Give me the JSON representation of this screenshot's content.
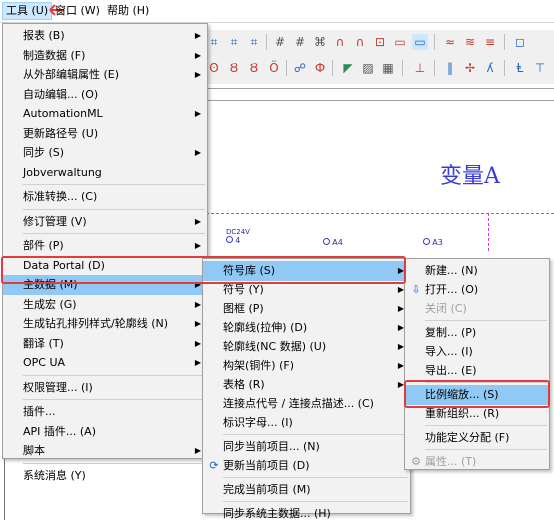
{
  "menubar": {
    "tools": "工具 (U)",
    "window": "窗口 (W)",
    "help": "帮助 (H)"
  },
  "canvas": {
    "title": "变量A",
    "connectors": [
      {
        "code": "DC24V",
        "num": "4"
      },
      {
        "code": "",
        "num": "A4"
      },
      {
        "code": "",
        "num": "A3"
      }
    ]
  },
  "tools_menu": {
    "items": [
      {
        "label": "报表 (B)",
        "sub": true
      },
      {
        "label": "制造数据 (F)",
        "sub": true
      },
      {
        "label": "从外部编辑属性 (E)",
        "sub": true
      },
      {
        "label": "自动编辑... (O)",
        "sub": false
      },
      {
        "label": "AutomationML",
        "sub": true
      },
      {
        "label": "更新路径号 (U)",
        "sub": false
      },
      {
        "label": "同步 (S)",
        "sub": true
      },
      {
        "label": "Jobverwaltung",
        "sub": false
      },
      {
        "label": "标准转换... (C)",
        "sub": false
      },
      {
        "label": "修订管理 (V)",
        "sub": true
      },
      {
        "label": "部件 (P)",
        "sub": true
      },
      {
        "label": "Data Portal (D)",
        "sub": false
      },
      {
        "label": "主数据 (M)",
        "sub": true
      },
      {
        "label": "生成宏 (G)",
        "sub": true
      },
      {
        "label": "生成钻孔排列样式/轮廓线 (N)",
        "sub": true
      },
      {
        "label": "翻译 (T)",
        "sub": true
      },
      {
        "label": "OPC UA",
        "sub": true
      },
      {
        "label": "权限管理... (I)",
        "sub": false
      },
      {
        "label": "插件...",
        "sub": false
      },
      {
        "label": "API 插件... (A)",
        "sub": false
      },
      {
        "label": "脚本",
        "sub": true
      },
      {
        "label": "系统消息 (Y)",
        "sub": false
      }
    ]
  },
  "master_menu": {
    "items": [
      {
        "label": "符号库 (S)",
        "sub": true
      },
      {
        "label": "符号 (Y)",
        "sub": true
      },
      {
        "label": "图框 (P)",
        "sub": true
      },
      {
        "label": "轮廓线(拉伸) (D)",
        "sub": true
      },
      {
        "label": "轮廓线(NC 数据) (U)",
        "sub": true
      },
      {
        "label": "构架(铜件) (F)",
        "sub": true
      },
      {
        "label": "表格 (R)",
        "sub": true
      },
      {
        "label": "连接点代号 / 连接点描述... (C)",
        "sub": false
      },
      {
        "label": "标识字母... (I)",
        "sub": false
      },
      {
        "label": "同步当前项目... (N)",
        "sub": false
      },
      {
        "label": "更新当前项目 (D)",
        "sub": false
      },
      {
        "label": "完成当前项目 (M)",
        "sub": false
      },
      {
        "label": "同步系统主数据... (H)",
        "sub": false
      }
    ]
  },
  "symlib_menu": {
    "items": [
      {
        "label": "新建... (N)",
        "disabled": false
      },
      {
        "label": "打开... (O)",
        "disabled": false
      },
      {
        "label": "关闭 (C)",
        "disabled": true
      },
      {
        "label": "复制... (P)",
        "disabled": false
      },
      {
        "label": "导入... (I)",
        "disabled": false
      },
      {
        "label": "导出... (E)",
        "disabled": false
      },
      {
        "label": "比例缩放... (S)",
        "disabled": false
      },
      {
        "label": "重新组织... (R)",
        "disabled": false
      },
      {
        "label": "功能定义分配 (F)",
        "disabled": false
      },
      {
        "label": "属性... (T)",
        "disabled": true
      }
    ]
  }
}
